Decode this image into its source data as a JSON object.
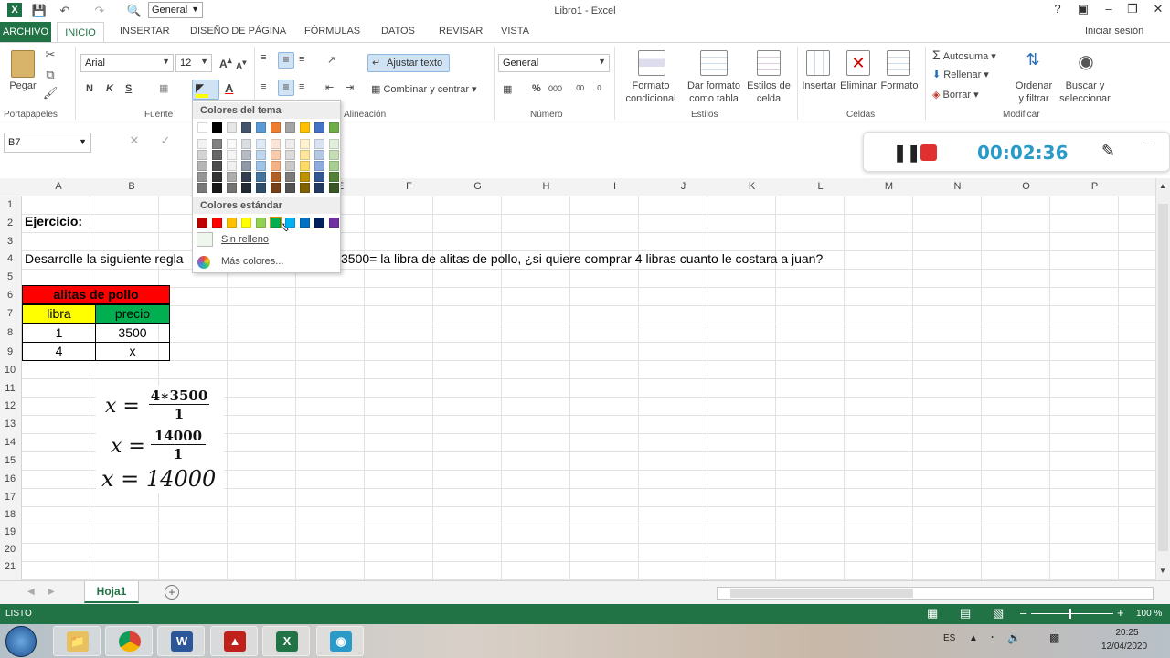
{
  "window": {
    "title": "Libro1 - Excel",
    "format_combo": "General"
  },
  "tabs": [
    "ARCHIVO",
    "INICIO",
    "INSERTAR",
    "DISEÑO DE PÁGINA",
    "FÓRMULAS",
    "DATOS",
    "REVISAR",
    "VISTA"
  ],
  "signin": "Iniciar sesión",
  "ribbon": {
    "paste": "Pegar",
    "font_name": "Arial",
    "font_size": "12",
    "bold": "N",
    "italic": "K",
    "underline": "S",
    "wrap_text": "Ajustar texto",
    "merge": "Combinar y centrar",
    "number_format": "General",
    "cond_format": [
      "Formato",
      "condicional"
    ],
    "format_table": [
      "Dar formato",
      "como tabla"
    ],
    "cell_styles": [
      "Estilos de",
      "celda"
    ],
    "insert": "Insertar",
    "delete": "Eliminar",
    "format": "Formato",
    "autosum": "Autosuma",
    "fill": "Rellenar",
    "clear": "Borrar",
    "sort": [
      "Ordenar",
      "y filtrar"
    ],
    "find": [
      "Buscar y",
      "seleccionar"
    ],
    "groups": {
      "clipboard": "Portapapeles",
      "font": "Fuente",
      "alignment": "Alineación",
      "number": "Número",
      "styles": "Estilos",
      "cells": "Celdas",
      "editing": "Modificar"
    }
  },
  "namebox": "B7",
  "columns": [
    "A",
    "B",
    "C",
    "D",
    "E",
    "F",
    "G",
    "H",
    "I",
    "J",
    "K",
    "L",
    "M",
    "N",
    "O",
    "P"
  ],
  "rows": [
    "1",
    "2",
    "3",
    "4",
    "5",
    "6",
    "7",
    "8",
    "9",
    "10",
    "11",
    "12",
    "13",
    "14",
    "15",
    "16",
    "17",
    "18",
    "19",
    "20",
    "21"
  ],
  "cells": {
    "a2": "Ejercicio:",
    "a4_left": "Desarrolle la siguiente regla",
    "a4_right": "3500= la libra de alitas de pollo, ¿si quiere comprar 4 libras cuanto le costara a juan?",
    "title": "alitas de pollo",
    "h_libra": "libra",
    "h_precio": "precio",
    "r8a": "1",
    "r8b": "3500",
    "r9a": "4",
    "r9b": "x"
  },
  "equations": {
    "l1_lhs": "x =",
    "l1_num": "4∗3500",
    "l1_den": "1",
    "l2_lhs": "x =",
    "l2_num": "14000",
    "l2_den": "1",
    "l3": "x = 14000"
  },
  "palette": {
    "theme_header": "Colores del tema",
    "standard_header": "Colores estándar",
    "no_fill": "Sin relleno",
    "more": "Más colores...",
    "theme_top": [
      "#ffffff",
      "#000000",
      "#e7e6e6",
      "#44546a",
      "#5b9bd5",
      "#ed7d31",
      "#a5a5a5",
      "#ffc000",
      "#4472c4",
      "#70ad47"
    ],
    "standard": [
      "#c00000",
      "#ff0000",
      "#ffc000",
      "#ffff00",
      "#92d050",
      "#00b050",
      "#00b0f0",
      "#0070c0",
      "#002060",
      "#7030a0"
    ]
  },
  "recorder": {
    "time": "00:02:36"
  },
  "sheet": "Hoja1",
  "status": {
    "ready": "LISTO",
    "zoom": "100 %"
  },
  "taskbar": {
    "lang": "ES",
    "time": "20:25",
    "date": "12/04/2020"
  },
  "colors": {
    "excel_green": "#217346",
    "red": "#ff0000",
    "yellow": "#ffff00",
    "green": "#00b050"
  }
}
